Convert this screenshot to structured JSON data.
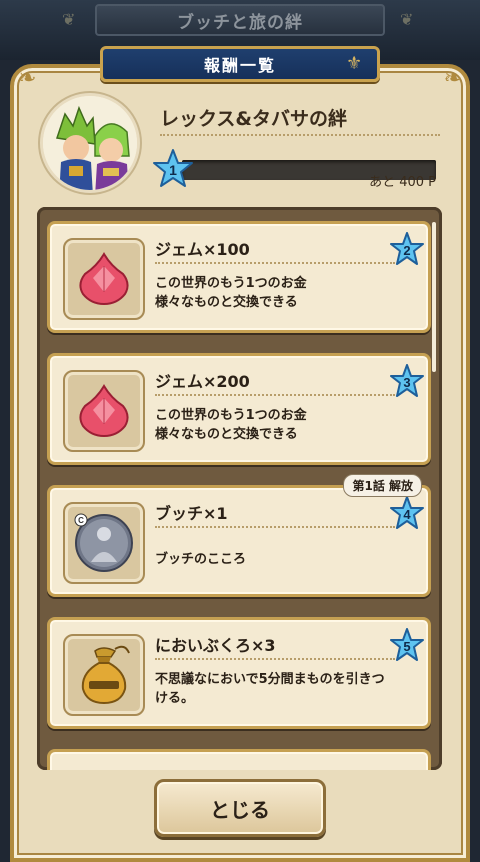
{
  "background": {
    "title": "ブッチと旅の絆"
  },
  "header": {
    "title": "報酬一覧"
  },
  "profile": {
    "name": "レックス&タバサの絆",
    "level": "1",
    "progress": 0.0,
    "remaining": "あと 400 P"
  },
  "rewards": [
    {
      "star": "2",
      "title": "ジェム×100",
      "desc1": "この世界のもう1つのお金",
      "desc2": "様々なものと交換できる",
      "icon": "gem-icon"
    },
    {
      "star": "3",
      "title": "ジェム×200",
      "desc1": "この世界のもう1つのお金",
      "desc2": "様々なものと交換できる",
      "icon": "gem-icon"
    },
    {
      "star": "4",
      "title": "ブッチ×1",
      "desc1": "ブッチのこころ",
      "desc2": "",
      "icon": "heart-orb-icon",
      "badge": "第1話 解放"
    },
    {
      "star": "5",
      "title": "においぶくろ×3",
      "desc1": "不思議なにおいで5分間まものを引きつ",
      "desc2": "ける。",
      "icon": "scent-bag-icon"
    }
  ],
  "close_button": {
    "label": "とじる"
  },
  "colors": {
    "accent_blue": "#2f8fd8",
    "gold": "#c5a052",
    "parchment": "#f4ead2"
  }
}
